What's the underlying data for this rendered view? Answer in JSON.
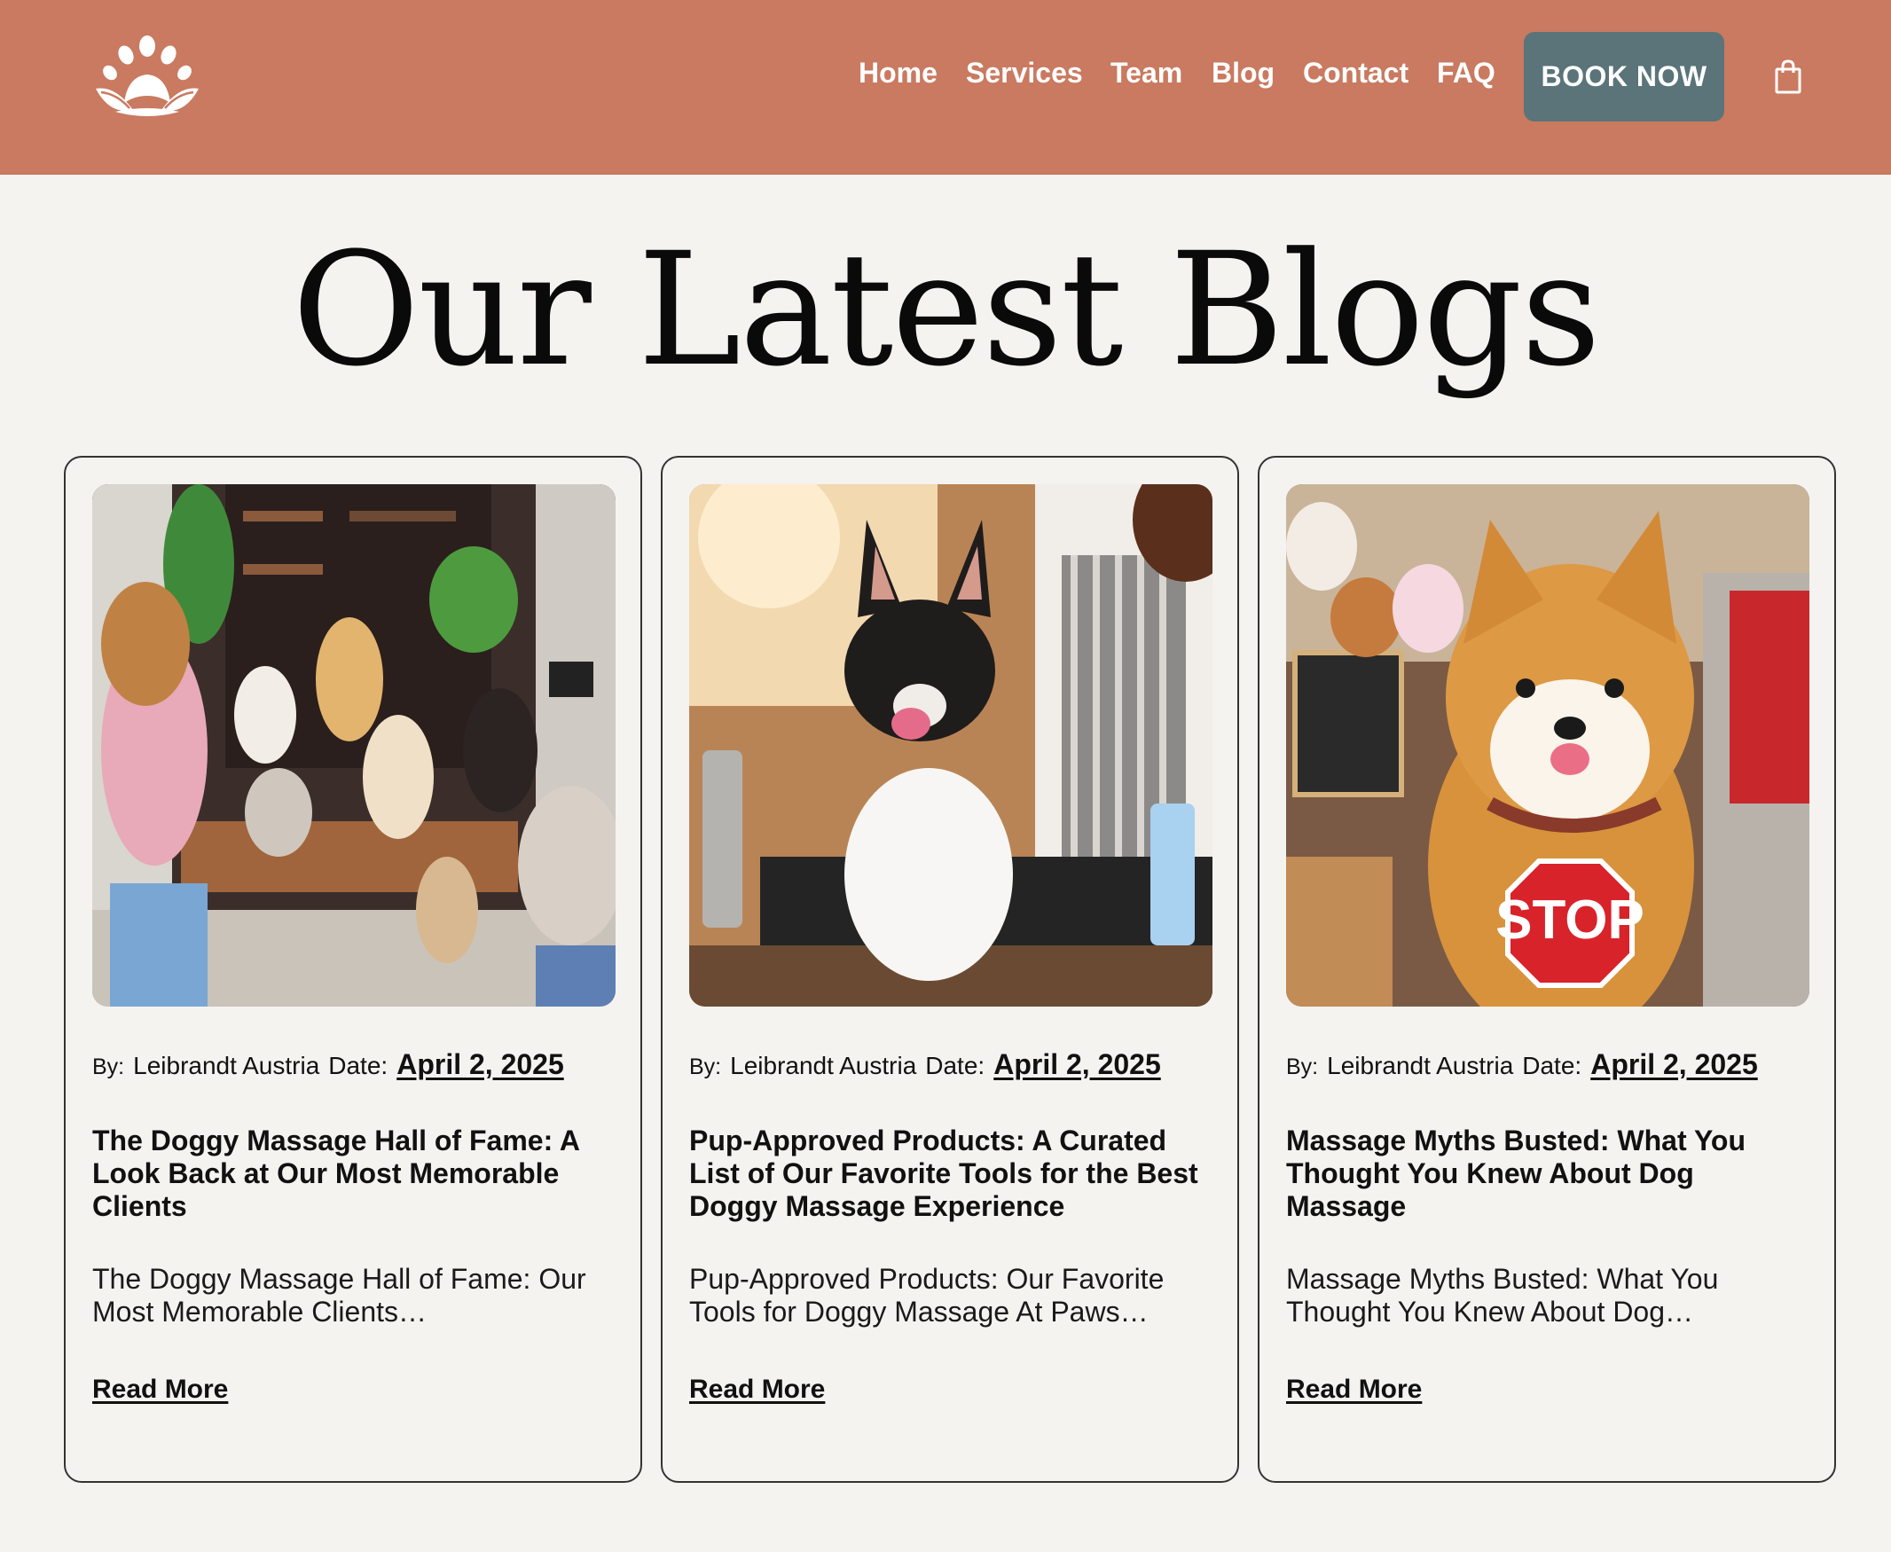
{
  "header": {
    "logo_icon": "paw-lotus-logo",
    "nav": [
      "Home",
      "Services",
      "Team",
      "Blog",
      "Contact",
      "FAQ"
    ],
    "cta_label": "BOOK NOW",
    "cart_icon": "shopping-bag-icon",
    "colors": {
      "bar": "#c97a60",
      "cta": "#5a7479"
    }
  },
  "page": {
    "title": "Our Latest Blogs"
  },
  "posts": [
    {
      "image_icon": "dogs-photoshoot-image",
      "by_label": "By:",
      "author": "Leibrandt Austria",
      "date_label": "Date:",
      "date": "April 2, 2025",
      "title": "The Doggy Massage Hall of Fame: A Look Back at Our Most Memorable Clients",
      "excerpt": "The Doggy Massage Hall of Fame: Our Most Memorable Clients…",
      "read_more": "Read More"
    },
    {
      "image_icon": "french-bulldog-grooming-image",
      "by_label": "By:",
      "author": "Leibrandt Austria",
      "date_label": "Date:",
      "date": "April 2, 2025",
      "title": "Pup-Approved Products: A Curated List of Our Favorite Tools for the Best Doggy Massage Experience",
      "excerpt": "Pup-Approved Products: Our Favorite Tools for Doggy Massage At Paws…",
      "read_more": "Read More"
    },
    {
      "image_icon": "shiba-stop-sign-image",
      "by_label": "By:",
      "author": "Leibrandt Austria",
      "date_label": "Date:",
      "date": "April 2, 2025",
      "title": "Massage Myths Busted: What You Thought You Knew About Dog Massage",
      "excerpt": "Massage Myths Busted: What You Thought You Knew About Dog…",
      "read_more": "Read More"
    }
  ]
}
